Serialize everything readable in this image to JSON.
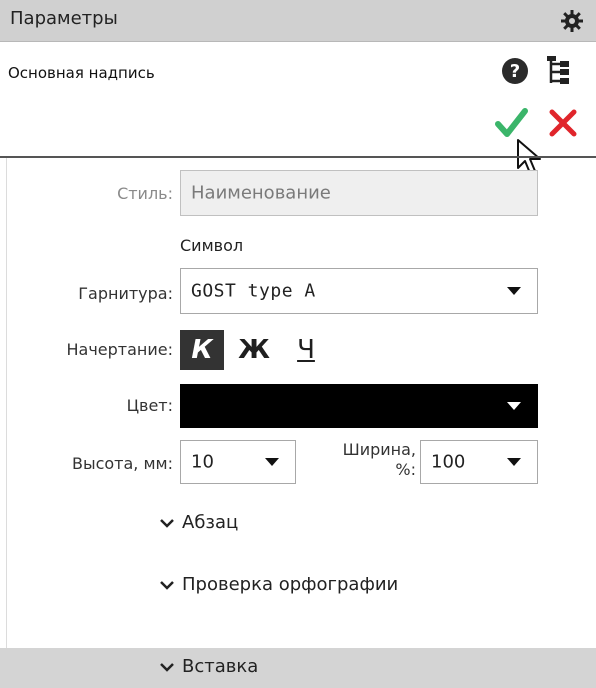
{
  "panel": {
    "title": "Параметры"
  },
  "header": {
    "subtitle": "Основная надпись"
  },
  "form": {
    "style_label": "Стиль:",
    "style_value": "Наименование",
    "symbol_heading": "Символ",
    "font_label": "Гарнитура:",
    "font_value": "GOST type A",
    "typeface_label": "Начертание:",
    "style_buttons": [
      "К",
      "Ж",
      "Ч"
    ],
    "color_label": "Цвет:",
    "color_value": "#000000",
    "height_label": "Высота, мм:",
    "height_value": "10",
    "width_label_line1": "Ширина,",
    "width_label_line2": "%:",
    "width_value": "100"
  },
  "groups": [
    "Абзац",
    "Проверка орфографии",
    "Вставка"
  ],
  "colors": {
    "ok": "#3bb56a",
    "cancel": "#e0252b",
    "titlebar": "#d0d0d0"
  }
}
